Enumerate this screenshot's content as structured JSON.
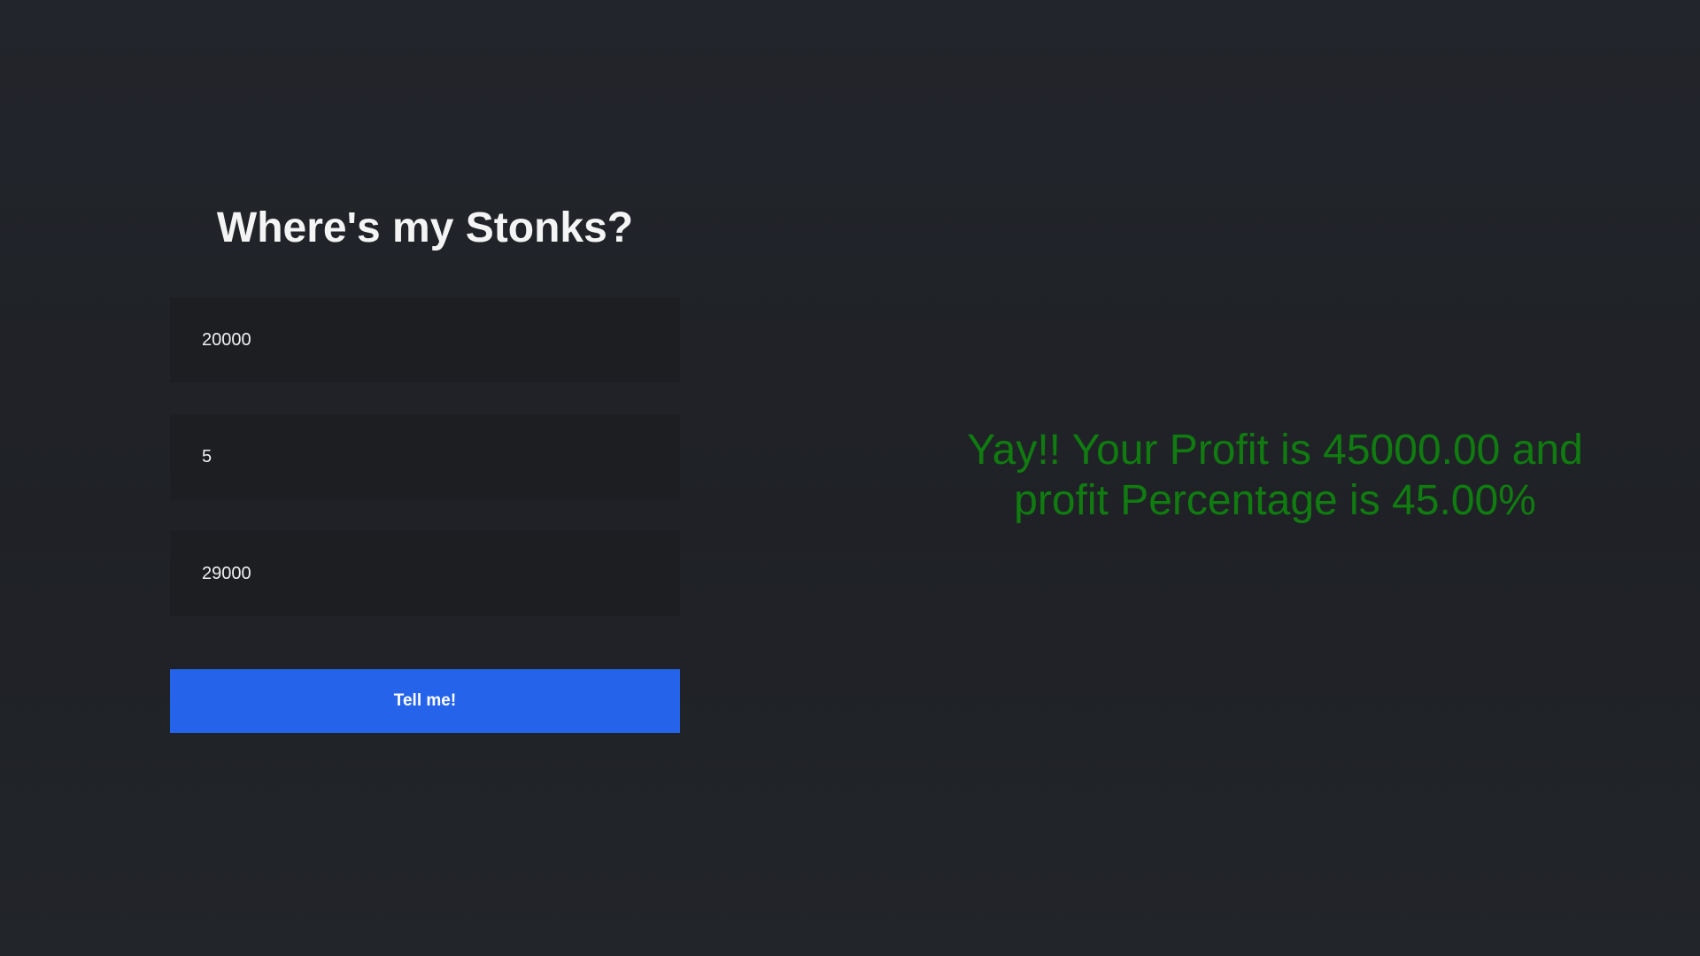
{
  "app": {
    "title": "Where's my Stonks?"
  },
  "form": {
    "fields": [
      {
        "value": "20000"
      },
      {
        "value": "5"
      },
      {
        "value": "29000"
      }
    ],
    "submit_label": "Tell me!"
  },
  "result": {
    "message": "Yay!! Your Profit is 45000.00 and profit Percentage is 45.00%",
    "color": "#107c10"
  },
  "colors": {
    "background": "#202328",
    "input_background": "#1c1e22",
    "button": "#2563eb",
    "title": "#f4f4f4",
    "result": "#107c10"
  }
}
